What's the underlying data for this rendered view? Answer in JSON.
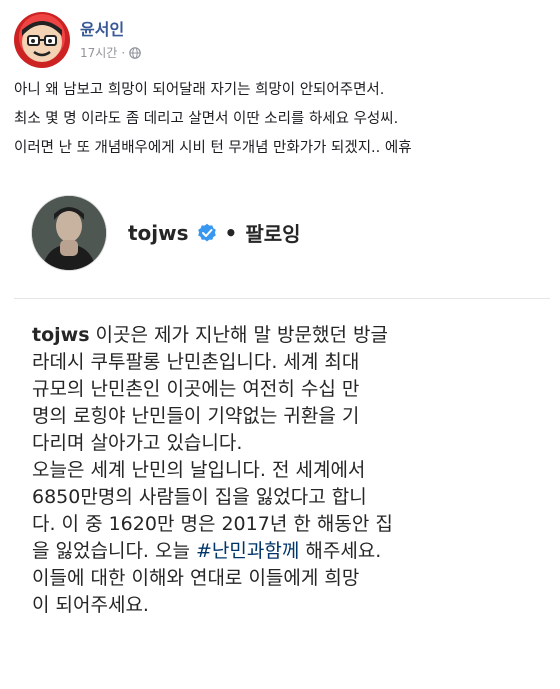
{
  "post": {
    "author": "윤서인",
    "time": "17시간",
    "separator": "·",
    "text_lines": [
      "아니 왜 남보고 희망이 되어달래 자기는 희망이 안되어주면서.",
      "최소 몇 명 이라도 좀 데리고 살면서 이딴 소리를 하세요 우성씨.",
      "이러면 난 또 개념배우에게 시비 턴 무개념 만화가가 되겠지.. 에휴"
    ]
  },
  "embed": {
    "username": "tojws",
    "separator": "•",
    "follow_label": "팔로잉",
    "caption": {
      "user": "tojws",
      "lines": [
        " 이곳은 제가 지난해 말 방문했던 방글",
        "라데시 쿠투팔롱 난민촌입니다. 세계 최대",
        "규모의 난민촌인 이곳에는 여전히 수십 만",
        "명의 로힝야 난민들이 기약없는 귀환을 기",
        "다리며 살아가고 있습니다.",
        "오늘은 세계 난민의 날입니다. 전 세계에서",
        "6850만명의 사람들이 집을 잃었다고 합니",
        "다. 이 중 1620만 명은 2017년 한 해동안 집"
      ],
      "line9_before": "을 잃었습니다. 오늘 ",
      "hashtag": "#난민과함께",
      "line9_after": " 해주세요.",
      "lines_end": [
        "이들에 대한 이해와 연대로 이들에게 희망",
        "이 되어주세요."
      ]
    }
  },
  "colors": {
    "link": "#385898",
    "meta": "#90949c",
    "verified": "#3897f0",
    "hashtag": "#003569"
  }
}
